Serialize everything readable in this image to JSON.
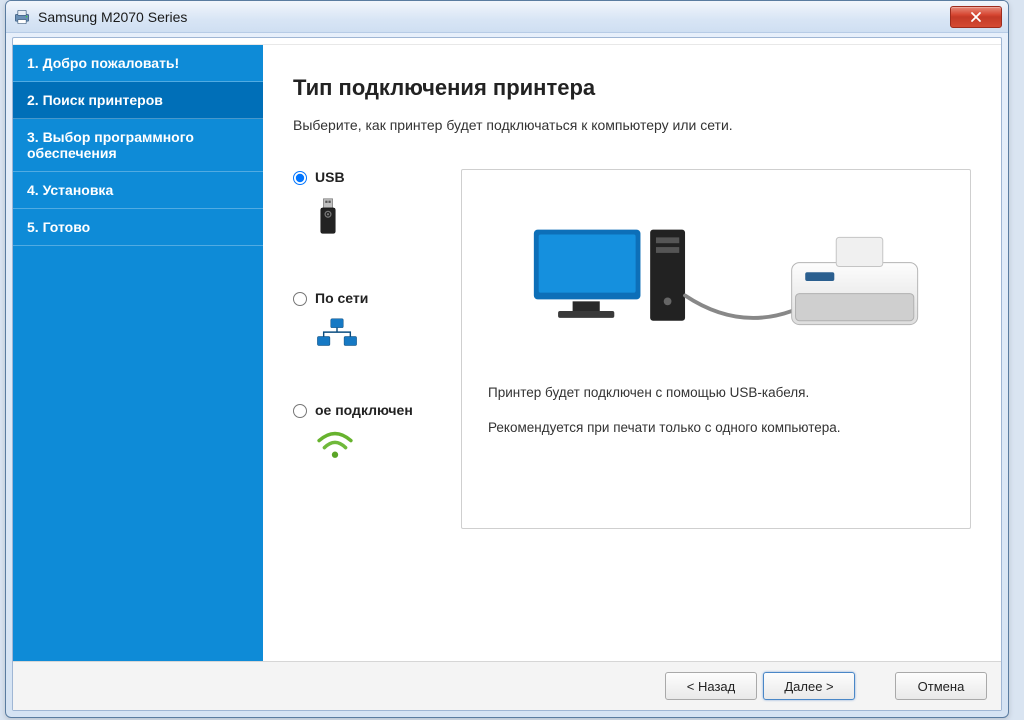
{
  "window": {
    "title": "Samsung M2070 Series"
  },
  "sidebar": {
    "steps": [
      {
        "label": "1. Добро пожаловать!"
      },
      {
        "label": "2. Поиск принтеров"
      },
      {
        "label": "3. Выбор программного обеспечения"
      },
      {
        "label": "4. Установка"
      },
      {
        "label": "5. Готово"
      }
    ],
    "active_index": 1
  },
  "main": {
    "heading": "Тип подключения принтера",
    "subheading": "Выберите, как принтер будет подключаться к компьютеру или сети.",
    "options": {
      "usb": {
        "label": "USB"
      },
      "network": {
        "label": "По сети"
      },
      "wireless": {
        "label": "ое подключен"
      }
    },
    "selected_option": "usb",
    "preview": {
      "line1": "Принтер будет подключен с помощью USB-кабеля.",
      "line2": "Рекомендуется при печати только с одного компьютера."
    }
  },
  "buttons": {
    "back": "< Назад",
    "next": "Далее >",
    "cancel": "Отмена"
  },
  "colors": {
    "sidebar_bg": "#0e8bd7",
    "sidebar_active": "#006fb8",
    "close_btn": "#d64530"
  }
}
